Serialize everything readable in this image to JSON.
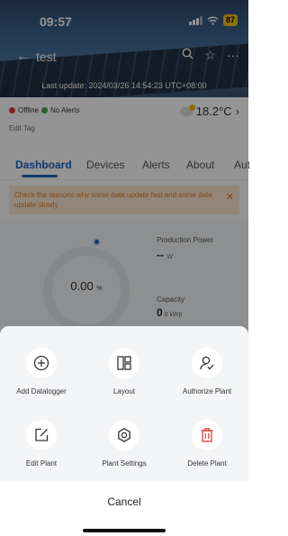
{
  "status_bar": {
    "time": "09:57",
    "battery": "87"
  },
  "header": {
    "title": "test",
    "last_update": "Last update: 2024/03/26 14:54:23 UTC+08:00"
  },
  "info": {
    "offline_label": "Offline",
    "alerts_label": "No Alerts",
    "temperature": "18.2°C",
    "edit_tag": "Edit Tag"
  },
  "tabs": [
    {
      "label": "Dashboard"
    },
    {
      "label": "Devices"
    },
    {
      "label": "Alerts"
    },
    {
      "label": "About"
    },
    {
      "label": "Aut"
    }
  ],
  "notice": {
    "text": "Check the reasons why some data update fast and some data update slowly."
  },
  "dashboard": {
    "gauge_value": "0.00",
    "gauge_unit": "%",
    "production_power_label": "Production Power",
    "production_power_value": "--",
    "production_power_unit": "W",
    "capacity_label": "Capacity",
    "capacity_value": "0",
    "capacity_unit": ".8 kWp"
  },
  "sheet": {
    "actions": [
      {
        "label": "Add Datalogger",
        "icon": "plus-circle-icon"
      },
      {
        "label": "Layout",
        "icon": "layout-icon"
      },
      {
        "label": "Authorize Plant",
        "icon": "user-authorize-icon"
      },
      {
        "label": "Edit Plant",
        "icon": "edit-icon"
      },
      {
        "label": "Plant Settings",
        "icon": "gear-icon"
      },
      {
        "label": "Delete Plant",
        "icon": "trash-icon"
      }
    ],
    "cancel_label": "Cancel"
  },
  "colors": {
    "accent": "#1565c0",
    "danger": "#e53935",
    "notice_text": "#e07a1f"
  }
}
